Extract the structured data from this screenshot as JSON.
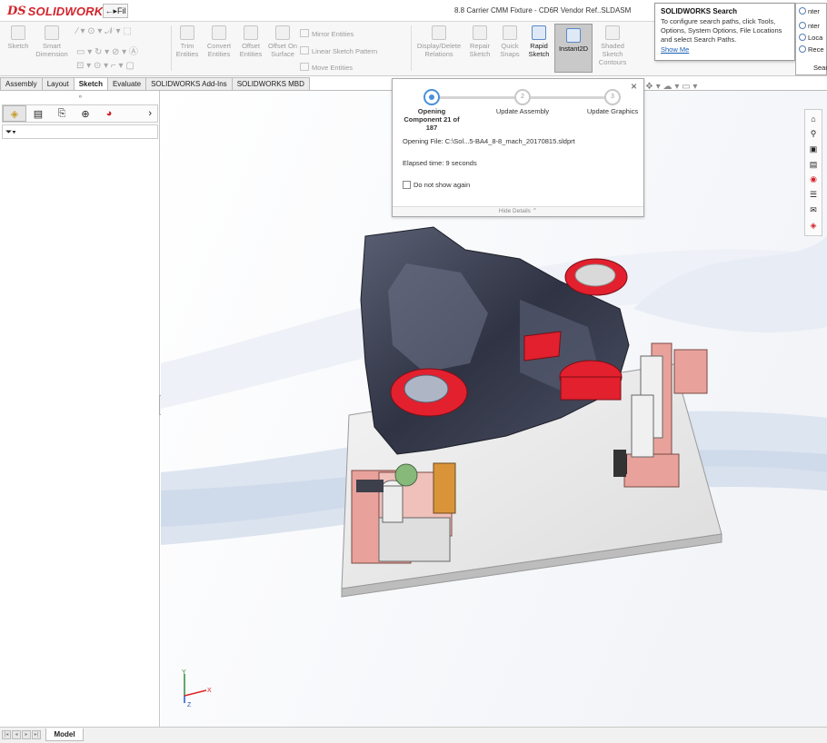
{
  "app": {
    "logo_prefix": "DS",
    "logo_text": "SOLIDWORKS",
    "pin_label": "←▸Fil"
  },
  "title": "8.8 Carrier CMM Fixture - CD6R Vendor Ref..SLDASM",
  "ribbon": {
    "sketch": "Sketch",
    "smart_dimension": "Smart Dimension",
    "trim_entities": "Trim Entities",
    "convert_entities": "Convert Entities",
    "offset_entities": "Offset Entities",
    "offset_on_surface": "Offset On Surface",
    "mirror_entities": "Mirror Entities",
    "linear_sketch_pattern": "Linear Sketch Pattern",
    "move_entities": "Move Entities",
    "display_delete_relations": "Display/Delete Relations",
    "repair_sketch": "Repair Sketch",
    "quick_snaps": "Quick Snaps",
    "rapid_sketch": "Rapid Sketch",
    "instant2d": "Instant2D",
    "shaded_sketch_contours": "Shaded Sketch Contours"
  },
  "tabs": [
    "Assembly",
    "Layout",
    "Sketch",
    "Evaluate",
    "SOLIDWORKS Add-Ins",
    "SOLIDWORKS MBD"
  ],
  "active_tab": "Sketch",
  "bottom": {
    "model_tab": "Model"
  },
  "loading": {
    "steps": [
      {
        "label": "Opening Component 21 of 187",
        "number": ""
      },
      {
        "label": "Update Assembly",
        "number": "2"
      },
      {
        "label": "Update Graphics",
        "number": "3"
      }
    ],
    "file": "Opening File: C:\\Sol...5-BA4_8-8_mach_20170815.sldprt",
    "elapsed": "Elapsed time: 9 seconds",
    "checkbox": "Do not show again",
    "footer": "Hide Details"
  },
  "search_popup": {
    "title": "SOLIDWORKS Search",
    "body": "To configure search paths, click Tools, Options, System Options, File Locations and select Search Paths.",
    "link": "Show Me"
  },
  "search_menu": {
    "item1": "nter",
    "item2": "nter",
    "item3": "Loca",
    "item4": "Rece",
    "search": "Sear"
  },
  "triad": {
    "x": "X",
    "y": "Y",
    "z": "Z"
  },
  "colors": {
    "brand": "#d2232a",
    "accent": "#4a90d9",
    "part_dark": "#3a3e4e",
    "part_red": "#e2202e",
    "fixture_pink": "#e8a29b"
  }
}
